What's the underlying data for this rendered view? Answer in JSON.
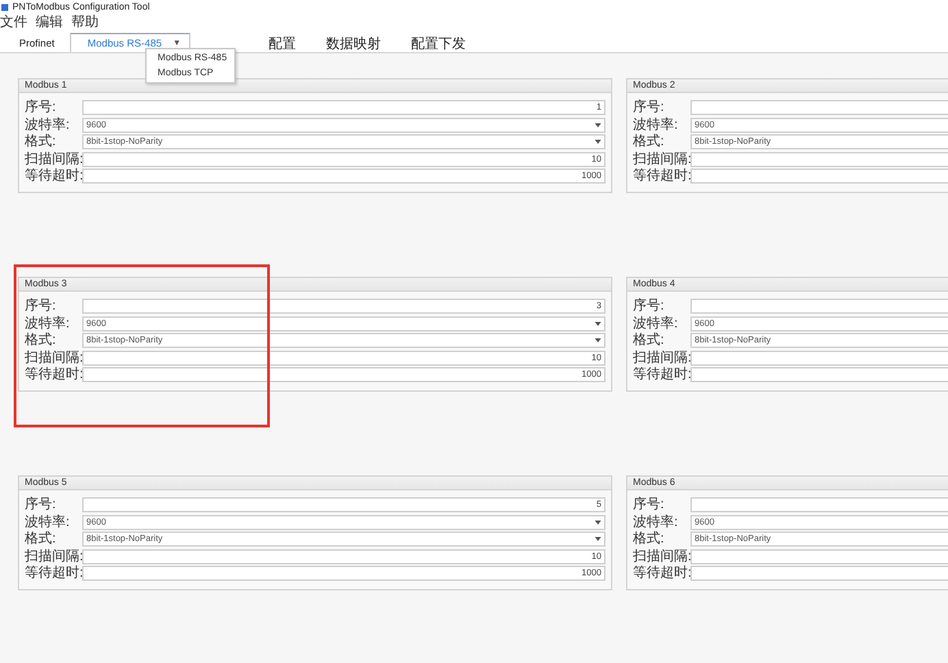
{
  "window": {
    "title": "PNToModbus Configuration Tool"
  },
  "menu": [
    "文件",
    "编辑",
    "帮助"
  ],
  "tabs": [
    {
      "label": "Profinet",
      "selected": false
    },
    {
      "label": "Modbus RS-485",
      "selected": true,
      "arrow": "▼"
    },
    {
      "label": "配置",
      "selected": false
    },
    {
      "label": "数据映射",
      "selected": false
    },
    {
      "label": "配置下发",
      "selected": false
    }
  ],
  "dropdown_menu": {
    "items": [
      "Modbus RS-485",
      "Modbus TCP"
    ]
  },
  "panels": [
    {
      "title": "Modbus 1",
      "highlighted": false,
      "fields": [
        {
          "label": "序号:",
          "kind": "number",
          "value": "1"
        },
        {
          "label": "波特率:",
          "kind": "combo",
          "value": "9600"
        },
        {
          "label": "格式:",
          "kind": "combo",
          "value": "8bit-1stop-NoParity"
        },
        {
          "label": "扫描间隔:",
          "kind": "number",
          "value": "10"
        },
        {
          "label": "等待超时:",
          "kind": "number",
          "value": "1000"
        }
      ]
    },
    {
      "title": "Modbus 2",
      "highlighted": false,
      "fields": [
        {
          "label": "序号:",
          "kind": "number"
        },
        {
          "label": "波特率:",
          "kind": "combo",
          "value": "9600"
        },
        {
          "label": "格式:",
          "kind": "combo",
          "value": "8bit-1stop-NoParity"
        },
        {
          "label": "扫描间隔:",
          "kind": "number"
        },
        {
          "label": "等待超时:",
          "kind": "number"
        }
      ]
    },
    {
      "title": "Modbus 3",
      "highlighted": true,
      "fields": [
        {
          "label": "序号:",
          "kind": "number",
          "value": "3"
        },
        {
          "label": "波特率:",
          "kind": "combo",
          "value": "9600"
        },
        {
          "label": "格式:",
          "kind": "combo",
          "value": "8bit-1stop-NoParity"
        },
        {
          "label": "扫描间隔:",
          "kind": "number",
          "value": "10"
        },
        {
          "label": "等待超时:",
          "kind": "number",
          "value": "1000"
        }
      ]
    },
    {
      "title": "Modbus 4",
      "highlighted": false,
      "fields": [
        {
          "label": "序号:",
          "kind": "number"
        },
        {
          "label": "波特率:",
          "kind": "combo",
          "value": "9600"
        },
        {
          "label": "格式:",
          "kind": "combo",
          "value": "8bit-1stop-NoParity"
        },
        {
          "label": "扫描间隔:",
          "kind": "number"
        },
        {
          "label": "等待超时:",
          "kind": "number"
        }
      ]
    },
    {
      "title": "Modbus 5",
      "highlighted": false,
      "fields": [
        {
          "label": "序号:",
          "kind": "number",
          "value": "5"
        },
        {
          "label": "波特率:",
          "kind": "combo",
          "value": "9600"
        },
        {
          "label": "格式:",
          "kind": "combo",
          "value": "8bit-1stop-NoParity"
        },
        {
          "label": "扫描间隔:",
          "kind": "number",
          "value": "10"
        },
        {
          "label": "等待超时:",
          "kind": "number",
          "value": "1000"
        }
      ]
    },
    {
      "title": "Modbus 6",
      "highlighted": false,
      "fields": [
        {
          "label": "序号:",
          "kind": "number"
        },
        {
          "label": "波特率:",
          "kind": "combo",
          "value": "9600"
        },
        {
          "label": "格式:",
          "kind": "combo",
          "value": "8bit-1stop-NoParity"
        },
        {
          "label": "扫描间隔:",
          "kind": "number"
        },
        {
          "label": "等待超时:",
          "kind": "number"
        }
      ]
    }
  ]
}
